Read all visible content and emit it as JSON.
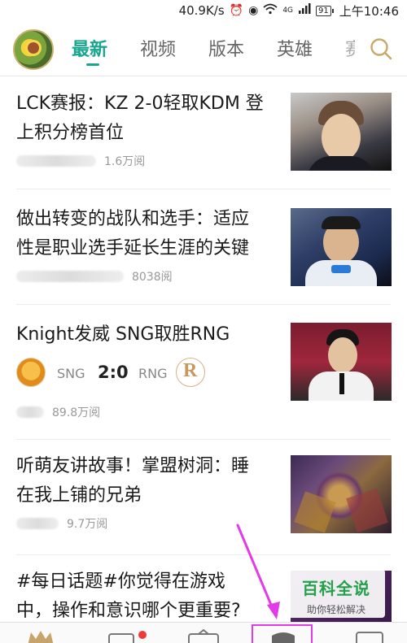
{
  "status_bar": {
    "network_speed": "40.9K/s",
    "alarm_icon": "alarm-icon",
    "eye_icon": "eye-icon",
    "wifi_icon": "wifi-icon",
    "network_type": "4G",
    "battery": "91",
    "time": "上午10:46"
  },
  "top_nav": {
    "tabs": [
      {
        "label": "最新",
        "active": true
      },
      {
        "label": "视频",
        "active": false
      },
      {
        "label": "版本",
        "active": false
      },
      {
        "label": "英雄",
        "active": false
      },
      {
        "label": "赛",
        "active": false
      }
    ],
    "search_icon": "search-icon",
    "accent_color": "#1aa58f"
  },
  "feed": [
    {
      "title_lines": [
        "LCK赛报：KZ 2-0轻取KDM 登",
        "上积分榜首位"
      ],
      "views": "1.6万阅"
    },
    {
      "title_lines": [
        "做出转变的战队和选手：适应",
        "性是职业选手延长生涯的关键"
      ],
      "views": "8038阅"
    },
    {
      "title_lines": [
        "Knight发威 SNG取胜RNG"
      ],
      "match": {
        "team_a": "SNG",
        "score": "2:0",
        "team_b": "RNG"
      },
      "views": "89.8万阅"
    },
    {
      "title_lines": [
        "听萌友讲故事！掌盟树洞：睡",
        "在我上铺的兄弟"
      ],
      "views": "9.7万阅"
    },
    {
      "title_lines": [
        "#每日话题#你觉得在游戏",
        "中，操作和意识哪个更重要?"
      ]
    }
  ],
  "watermark": {
    "title": "百科全说",
    "subtitle": "助你轻松解决"
  },
  "bottom_nav": {
    "items": [
      "home-icon",
      "messages-icon",
      "tv-icon",
      "games-icon",
      "profile-icon"
    ],
    "highlighted_index": 3,
    "highlight_color": "#e23be8"
  }
}
